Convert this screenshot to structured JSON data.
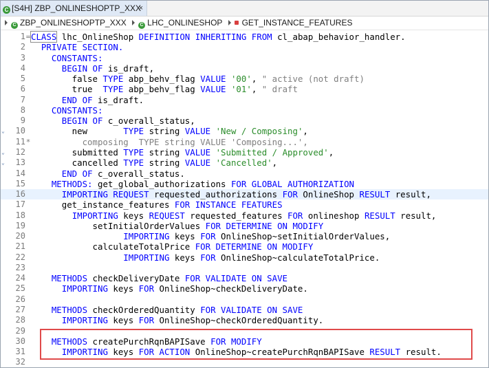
{
  "tab": {
    "title": "[S4H] ZBP_ONLINESHOPTP_XXX",
    "close": "×"
  },
  "breadcrumb": [
    "ZBP_ONLINESHOPTP_XXX",
    "LHC_ONLINESHOP",
    "GET_INSTANCE_FEATURES"
  ],
  "lines": [
    {
      "n": "1",
      "m": "=",
      "t": [
        [
          "CLASS",
          "kw box"
        ],
        [
          " lhc_OnlineShop ",
          ""
        ],
        [
          "DEFINITION INHERITING FROM",
          "kw"
        ],
        [
          " cl_abap_behavior_handler.",
          ""
        ]
      ]
    },
    {
      "n": "2",
      "t": [
        [
          "  ",
          ""
        ],
        [
          "PRIVATE SECTION.",
          "kw"
        ]
      ]
    },
    {
      "n": "3",
      "t": [
        [
          "    ",
          ""
        ],
        [
          "CONSTANTS:",
          "kw"
        ]
      ]
    },
    {
      "n": "4",
      "t": [
        [
          "      ",
          ""
        ],
        [
          "BEGIN OF",
          "kw"
        ],
        [
          " is_draft,",
          ""
        ]
      ]
    },
    {
      "n": "5",
      "t": [
        [
          "        false ",
          ""
        ],
        [
          "TYPE",
          "kw"
        ],
        [
          " abp_behv_flag ",
          ""
        ],
        [
          "VALUE",
          "kw"
        ],
        [
          " ",
          ""
        ],
        [
          "'00'",
          "str"
        ],
        [
          ", ",
          ""
        ],
        [
          "\" active (not draft)",
          "cm"
        ]
      ]
    },
    {
      "n": "6",
      "t": [
        [
          "        true  ",
          ""
        ],
        [
          "TYPE",
          "kw"
        ],
        [
          " abp_behv_flag ",
          ""
        ],
        [
          "VALUE",
          "kw"
        ],
        [
          " ",
          ""
        ],
        [
          "'01'",
          "str"
        ],
        [
          ", ",
          ""
        ],
        [
          "\" draft",
          "cm"
        ]
      ]
    },
    {
      "n": "7",
      "t": [
        [
          "      ",
          ""
        ],
        [
          "END OF",
          "kw"
        ],
        [
          " is_draft.",
          ""
        ]
      ]
    },
    {
      "n": "8",
      "t": [
        [
          "    ",
          ""
        ],
        [
          "CONSTANTS:",
          "kw"
        ]
      ]
    },
    {
      "n": "9",
      "t": [
        [
          "      ",
          ""
        ],
        [
          "BEGIN OF",
          "kw"
        ],
        [
          " c_overall_status,",
          ""
        ]
      ]
    },
    {
      "n": "10",
      "f": true,
      "t": [
        [
          "        new       ",
          ""
        ],
        [
          "TYPE",
          "kw"
        ],
        [
          " string ",
          ""
        ],
        [
          "VALUE",
          "kw"
        ],
        [
          " ",
          ""
        ],
        [
          "'New / Composing'",
          "str"
        ],
        [
          ",",
          ""
        ]
      ]
    },
    {
      "n": "11",
      "m": "*",
      "t": [
        [
          "          composing  TYPE string VALUE 'Composing...',",
          "cm"
        ]
      ]
    },
    {
      "n": "12",
      "f": true,
      "t": [
        [
          "        submitted ",
          ""
        ],
        [
          "TYPE",
          "kw"
        ],
        [
          " string ",
          ""
        ],
        [
          "VALUE",
          "kw"
        ],
        [
          " ",
          ""
        ],
        [
          "'Submitted / Approved'",
          "str"
        ],
        [
          ",",
          ""
        ]
      ]
    },
    {
      "n": "13",
      "f": true,
      "t": [
        [
          "        cancelled ",
          ""
        ],
        [
          "TYPE",
          "kw"
        ],
        [
          " string ",
          ""
        ],
        [
          "VALUE",
          "kw"
        ],
        [
          " ",
          ""
        ],
        [
          "'Cancelled'",
          "str"
        ],
        [
          ",",
          ""
        ]
      ]
    },
    {
      "n": "14",
      "t": [
        [
          "      ",
          ""
        ],
        [
          "END OF",
          "kw"
        ],
        [
          " c_overall_status.",
          ""
        ]
      ]
    },
    {
      "n": "15",
      "t": [
        [
          "    ",
          ""
        ],
        [
          "METHODS:",
          "kw"
        ],
        [
          " get_global_authorizations ",
          ""
        ],
        [
          "FOR GLOBAL AUTHORIZATION",
          "kw"
        ]
      ]
    },
    {
      "n": "16",
      "h": true,
      "t": [
        [
          "      ",
          ""
        ],
        [
          "IMPORTING REQUEST",
          "kw"
        ],
        [
          " requested_authorizations ",
          ""
        ],
        [
          "FOR",
          "kw"
        ],
        [
          " OnlineShop ",
          ""
        ],
        [
          "RESULT",
          "kw"
        ],
        [
          " result,",
          ""
        ]
      ]
    },
    {
      "n": "17",
      "t": [
        [
          "      get_instance_features ",
          ""
        ],
        [
          "FOR INSTANCE FEATURES",
          "kw"
        ]
      ]
    },
    {
      "n": "18",
      "t": [
        [
          "        ",
          ""
        ],
        [
          "IMPORTING",
          "kw"
        ],
        [
          " keys ",
          ""
        ],
        [
          "REQUEST",
          "kw"
        ],
        [
          " requested_features ",
          ""
        ],
        [
          "FOR",
          "kw"
        ],
        [
          " onlineshop ",
          ""
        ],
        [
          "RESULT",
          "kw"
        ],
        [
          " result,",
          ""
        ]
      ]
    },
    {
      "n": "19",
      "t": [
        [
          "            setInitialOrderValues ",
          ""
        ],
        [
          "FOR DETERMINE ON MODIFY",
          "kw"
        ]
      ]
    },
    {
      "n": "20",
      "t": [
        [
          "                  ",
          ""
        ],
        [
          "IMPORTING",
          "kw"
        ],
        [
          " keys ",
          ""
        ],
        [
          "FOR",
          "kw"
        ],
        [
          " OnlineShop~setInitialOrderValues,",
          ""
        ]
      ]
    },
    {
      "n": "21",
      "t": [
        [
          "            calculateTotalPrice ",
          ""
        ],
        [
          "FOR DETERMINE ON MODIFY",
          "kw"
        ]
      ]
    },
    {
      "n": "22",
      "t": [
        [
          "                  ",
          ""
        ],
        [
          "IMPORTING",
          "kw"
        ],
        [
          " keys ",
          ""
        ],
        [
          "FOR",
          "kw"
        ],
        [
          " OnlineShop~calculateTotalPrice.",
          ""
        ]
      ]
    },
    {
      "n": "23",
      "t": []
    },
    {
      "n": "24",
      "t": [
        [
          "    ",
          ""
        ],
        [
          "METHODS",
          "kw"
        ],
        [
          " checkDeliveryDate ",
          ""
        ],
        [
          "FOR VALIDATE ON SAVE",
          "kw"
        ]
      ]
    },
    {
      "n": "25",
      "t": [
        [
          "      ",
          ""
        ],
        [
          "IMPORTING",
          "kw"
        ],
        [
          " keys ",
          ""
        ],
        [
          "FOR",
          "kw"
        ],
        [
          " OnlineShop~checkDeliveryDate.",
          ""
        ]
      ]
    },
    {
      "n": "26",
      "t": []
    },
    {
      "n": "27",
      "t": [
        [
          "    ",
          ""
        ],
        [
          "METHODS",
          "kw"
        ],
        [
          " checkOrderedQuantity ",
          ""
        ],
        [
          "FOR VALIDATE ON SAVE",
          "kw"
        ]
      ]
    },
    {
      "n": "28",
      "t": [
        [
          "      ",
          ""
        ],
        [
          "IMPORTING",
          "kw"
        ],
        [
          " keys ",
          ""
        ],
        [
          "FOR",
          "kw"
        ],
        [
          " OnlineShop~checkOrderedQuantity.",
          ""
        ]
      ]
    },
    {
      "n": "29",
      "t": []
    },
    {
      "n": "30",
      "t": [
        [
          "    ",
          ""
        ],
        [
          "METHODS",
          "kw"
        ],
        [
          " createPurchRqnBAPISave ",
          ""
        ],
        [
          "FOR MODIFY",
          "kw"
        ]
      ]
    },
    {
      "n": "31",
      "t": [
        [
          "      ",
          ""
        ],
        [
          "IMPORTING",
          "kw"
        ],
        [
          " keys ",
          ""
        ],
        [
          "FOR ACTION",
          "kw"
        ],
        [
          " OnlineShop~createPurchRqnBAPISave ",
          ""
        ],
        [
          "RESULT",
          "kw"
        ],
        [
          " result.",
          ""
        ]
      ]
    },
    {
      "n": "32",
      "t": []
    }
  ]
}
